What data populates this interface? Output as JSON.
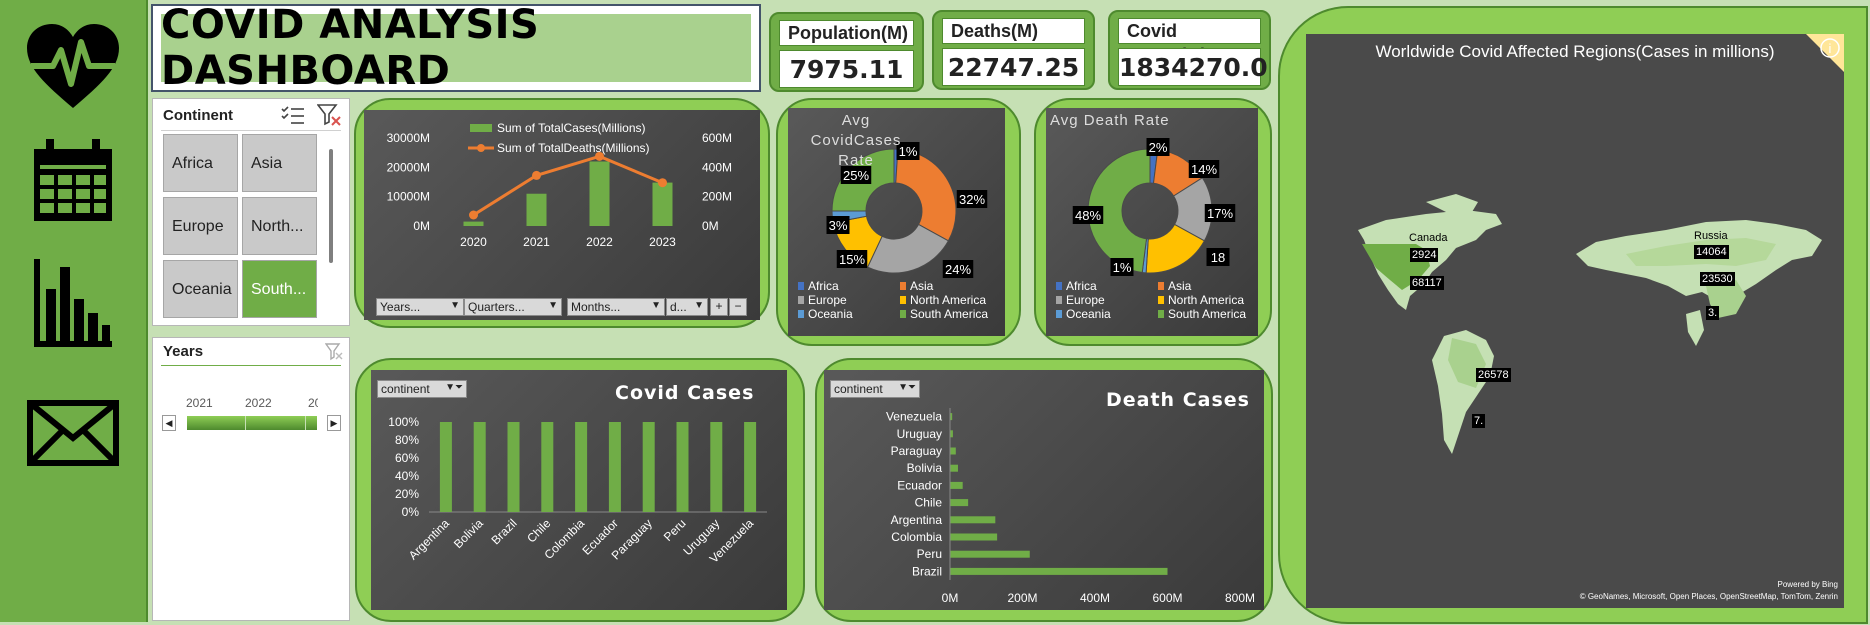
{
  "title": "COVID ANALYSIS DASHBOARD",
  "icons": [
    "heart-pulse-icon",
    "calendar-icon",
    "bar-chart-icon",
    "mail-icon"
  ],
  "kpis": [
    {
      "label": "Population(M)",
      "value": "7975.11"
    },
    {
      "label": "Deaths(M)",
      "value": "22747.25"
    },
    {
      "label": "Covid Cases(M)",
      "value": "1834270.0"
    }
  ],
  "continent_slicer": {
    "title": "Continent",
    "items": [
      {
        "label": "Africa",
        "selected": false
      },
      {
        "label": "Asia",
        "selected": false
      },
      {
        "label": "Europe",
        "selected": false
      },
      {
        "label": "North...",
        "selected": false
      },
      {
        "label": "Oceania",
        "selected": false
      },
      {
        "label": "South...",
        "selected": true
      }
    ]
  },
  "years_slicer": {
    "title": "Years",
    "labels": [
      "2021",
      "2022",
      "20"
    ]
  },
  "pivot_filters": [
    "Years...",
    "Quarters...",
    "Months...",
    "d..."
  ],
  "colors": {
    "green": "#70ad47",
    "orange": "#ed7d31",
    "gray": "#a5a5a5",
    "yellow": "#ffc000",
    "blue": "#5b9bd5",
    "darkblue": "#4472c4"
  },
  "chart_data": [
    {
      "type": "bar",
      "legend": [
        "Sum of TotalCases(Millions)",
        "Sum of TotalDeaths(Millions)"
      ],
      "categories": [
        "2020",
        "2021",
        "2022",
        "2023"
      ],
      "series": [
        {
          "name": "Sum of TotalCases(Millions)",
          "type": "bar",
          "axis": "left",
          "values": [
            1500,
            11000,
            22000,
            14800
          ]
        },
        {
          "name": "Sum of TotalDeaths(Millions)",
          "type": "line",
          "axis": "right",
          "values": [
            75,
            345,
            475,
            295
          ]
        }
      ],
      "y_ticks": [
        "0M",
        "10000M",
        "20000M",
        "30000M"
      ],
      "y2_ticks": [
        "0M",
        "200M",
        "400M",
        "600M"
      ],
      "ylim": [
        0,
        30000
      ],
      "y2lim": [
        0,
        600
      ]
    },
    {
      "type": "pie",
      "title": "Avg CovidCases Rate",
      "categories": [
        "Africa",
        "Asia",
        "Europe",
        "North America",
        "Oceania",
        "South America"
      ],
      "values": [
        1,
        32,
        24,
        15,
        3,
        25
      ],
      "labels": [
        "1%",
        "32%",
        "24%",
        "15%",
        "3%",
        "25%"
      ]
    },
    {
      "type": "pie",
      "title": "Avg Death Rate",
      "categories": [
        "Africa",
        "Asia",
        "Europe",
        "North America",
        "Oceania",
        "South America"
      ],
      "values": [
        2,
        14,
        17,
        18,
        1,
        48
      ],
      "labels": [
        "2%",
        "14%",
        "17%",
        "18",
        "1%",
        "48%"
      ]
    },
    {
      "type": "bar",
      "title": "Covid Cases",
      "filter": "continent",
      "categories": [
        "Argentina",
        "Bolivia",
        "Brazil",
        "Chile",
        "Colombia",
        "Ecuador",
        "Paraguay",
        "Peru",
        "Uruguay",
        "Venezuela"
      ],
      "values": [
        100,
        100,
        100,
        100,
        100,
        100,
        100,
        100,
        100,
        100
      ],
      "y_ticks": [
        "0%",
        "20%",
        "40%",
        "60%",
        "80%",
        "100%"
      ],
      "ylim": [
        0,
        100
      ]
    },
    {
      "type": "bar",
      "orientation": "horizontal",
      "title": "Death Cases",
      "filter": "continent",
      "categories": [
        "Venezuela",
        "Uruguay",
        "Paraguay",
        "Bolivia",
        "Ecuador",
        "Chile",
        "Argentina",
        "Colombia",
        "Peru",
        "Brazil"
      ],
      "values": [
        6,
        8,
        16,
        22,
        35,
        50,
        125,
        130,
        220,
        600
      ],
      "x_ticks": [
        "0M",
        "200M",
        "400M",
        "600M",
        "800M"
      ],
      "xlim": [
        0,
        800
      ]
    }
  ],
  "map": {
    "title": "Worldwide Covid Affected Regions(Cases in millions)",
    "labels": [
      {
        "name": "Canada",
        "value": "2924"
      },
      {
        "name": "",
        "value": "68117"
      },
      {
        "name": "Russia",
        "value": "14064"
      },
      {
        "name": "",
        "value": "23530"
      },
      {
        "name": "",
        "value": "3."
      },
      {
        "name": "",
        "value": "26578"
      },
      {
        "name": "",
        "value": "7."
      }
    ],
    "powered_by": "Powered by Bing",
    "attribution": "© GeoNames, Microsoft, Open Places, OpenStreetMap, TomTom, Zenrin"
  }
}
